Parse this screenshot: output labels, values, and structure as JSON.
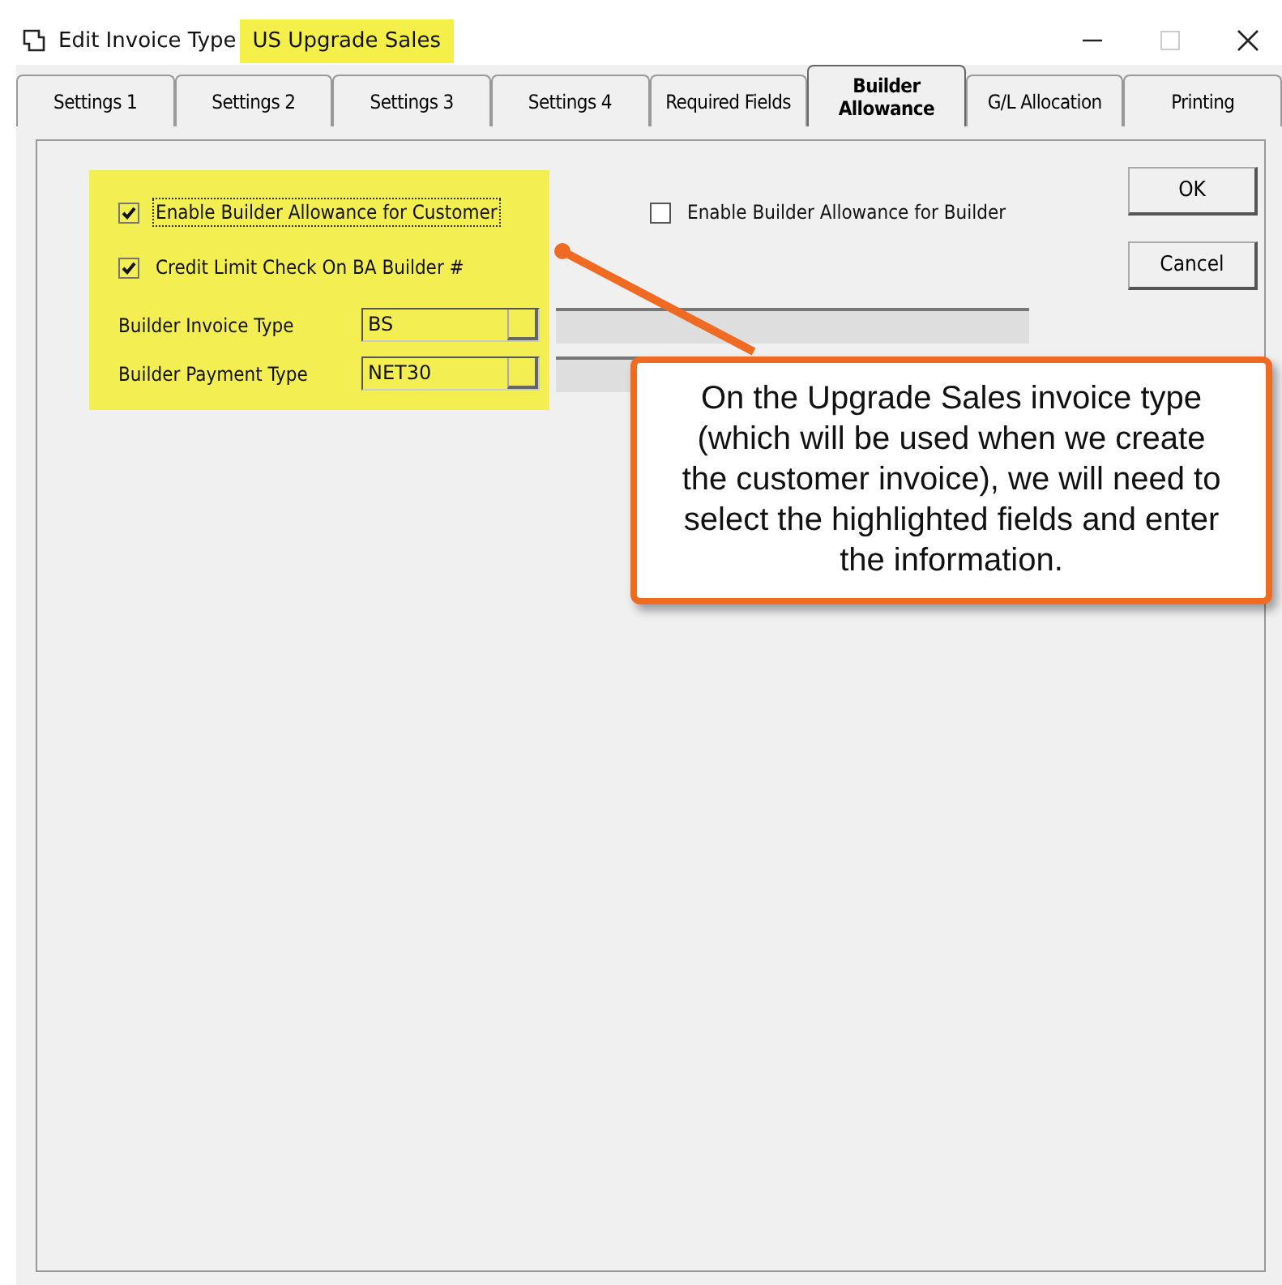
{
  "window": {
    "title": "Edit Invoice Type",
    "title_highlight": "US Upgrade Sales"
  },
  "tabs": [
    {
      "label": "Settings 1",
      "selected": false
    },
    {
      "label": "Settings 2",
      "selected": false
    },
    {
      "label": "Settings 3",
      "selected": false
    },
    {
      "label": "Settings 4",
      "selected": false
    },
    {
      "label": "Required Fields",
      "selected": false
    },
    {
      "label": "Builder Allowance",
      "selected": true
    },
    {
      "label": "G/L Allocation",
      "selected": false
    },
    {
      "label": "Printing",
      "selected": false
    }
  ],
  "checkboxes": [
    {
      "label": "Enable Builder Allowance for Customer",
      "checked": true,
      "focused": true
    },
    {
      "label": "Credit Limit Check On BA Builder #",
      "checked": true,
      "focused": false
    }
  ],
  "builder_checkbox": {
    "label": "Enable Builder Allowance for Builder",
    "checked": false
  },
  "fields": [
    {
      "label": "Builder Invoice Type",
      "value": "BS"
    },
    {
      "label": "Builder Payment Type",
      "value": "NET30"
    }
  ],
  "buttons": [
    "OK",
    "Cancel"
  ],
  "callout": "On the Upgrade Sales invoice type (which will be used when we create the customer invoice), we will need to select the highlighted fields and enter the information."
}
